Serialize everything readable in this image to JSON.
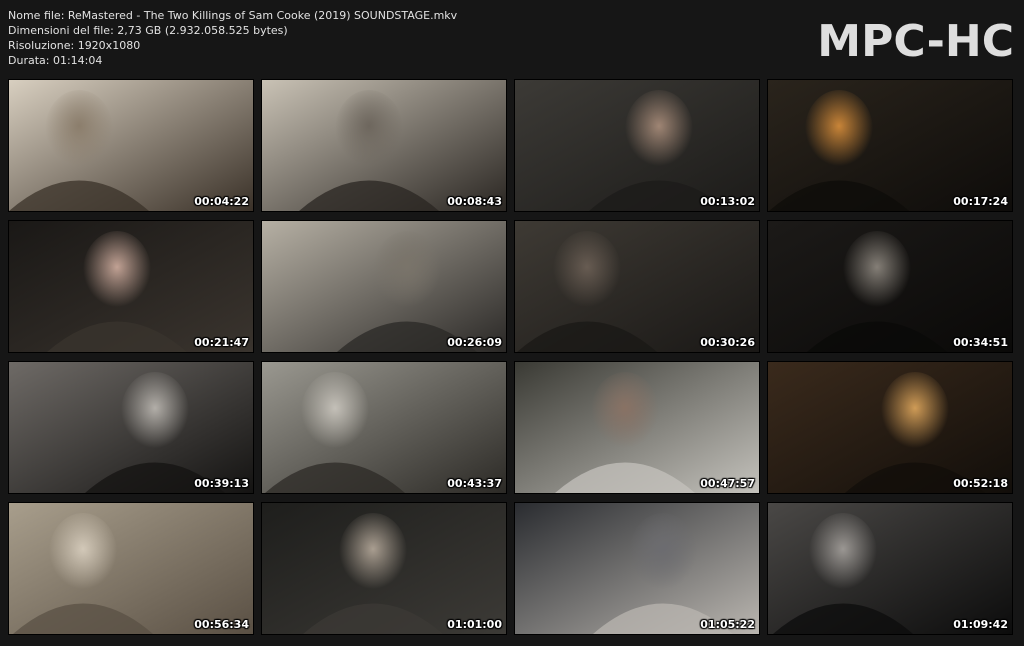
{
  "info": {
    "filename": "Nome file: ReMastered - The Two Killings of Sam Cooke (2019) SOUNDSTAGE.mkv",
    "filesize": "Dimensioni del file: 2,73 GB (2.932.058.525 bytes)",
    "resolution": "Risoluzione: 1920x1080",
    "duration": "Durata: 01:14:04"
  },
  "logo": "MPC-HC",
  "thumbnails": [
    {
      "time": "00:04:22",
      "palette": [
        "#d8cfc0",
        "#3a3128",
        "#8a7c6a"
      ]
    },
    {
      "time": "00:08:43",
      "palette": [
        "#c9c2b5",
        "#2a2622",
        "#6c655c"
      ]
    },
    {
      "time": "00:13:02",
      "palette": [
        "#3c3a36",
        "#1c1b19",
        "#a58a78"
      ]
    },
    {
      "time": "00:17:24",
      "palette": [
        "#2a241c",
        "#0e0c0a",
        "#d18a3a"
      ]
    },
    {
      "time": "00:21:47",
      "palette": [
        "#1a1816",
        "#3a342e",
        "#c9a89a"
      ]
    },
    {
      "time": "00:26:09",
      "palette": [
        "#b6b0a4",
        "#2a2826",
        "#7a746a"
      ]
    },
    {
      "time": "00:30:26",
      "palette": [
        "#3e3a34",
        "#1a1816",
        "#6a5e54"
      ]
    },
    {
      "time": "00:34:51",
      "palette": [
        "#1c1a18",
        "#0a0908",
        "#8a847c"
      ]
    },
    {
      "time": "00:39:13",
      "palette": [
        "#6e6a66",
        "#141312",
        "#b8b4ae"
      ]
    },
    {
      "time": "00:43:37",
      "palette": [
        "#9a9890",
        "#2c2a26",
        "#c8c4bc"
      ]
    },
    {
      "time": "00:47:57",
      "palette": [
        "#3a3a34",
        "#c4c2bc",
        "#8a7264"
      ]
    },
    {
      "time": "00:52:18",
      "palette": [
        "#3a2a1c",
        "#120e0a",
        "#d8a25a"
      ]
    },
    {
      "time": "00:56:34",
      "palette": [
        "#a89e8c",
        "#5a5044",
        "#d6ccbc"
      ]
    },
    {
      "time": "01:01:00",
      "palette": [
        "#1e1e1c",
        "#3c3a36",
        "#b0a496"
      ]
    },
    {
      "time": "01:05:22",
      "palette": [
        "#2a2c30",
        "#bab6b0",
        "#6c6c70"
      ]
    },
    {
      "time": "01:09:42",
      "palette": [
        "#4a4846",
        "#0c0c0c",
        "#a09c98"
      ]
    }
  ]
}
